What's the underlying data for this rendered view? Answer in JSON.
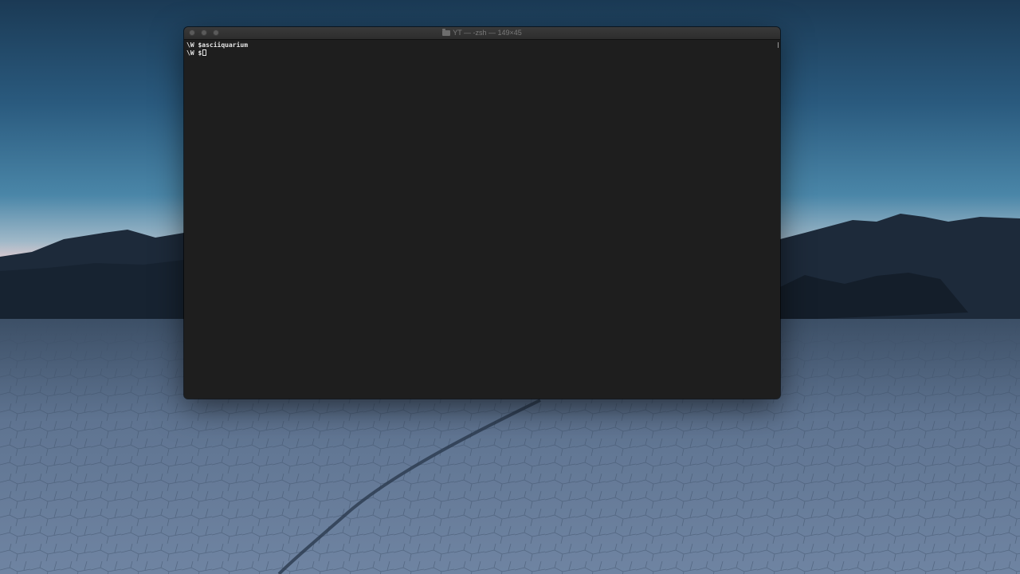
{
  "window": {
    "title": "YT — -zsh — 149×45",
    "folder_icon": "folder-icon"
  },
  "terminal": {
    "lines": [
      {
        "prompt": "\\W $",
        "command": "asciiquarium"
      },
      {
        "prompt": "\\W $",
        "command": ""
      }
    ]
  },
  "colors": {
    "terminal_bg": "#1e1e1e",
    "terminal_text": "#e6e6e6",
    "titlebar_bg": "#2d2d2d"
  }
}
